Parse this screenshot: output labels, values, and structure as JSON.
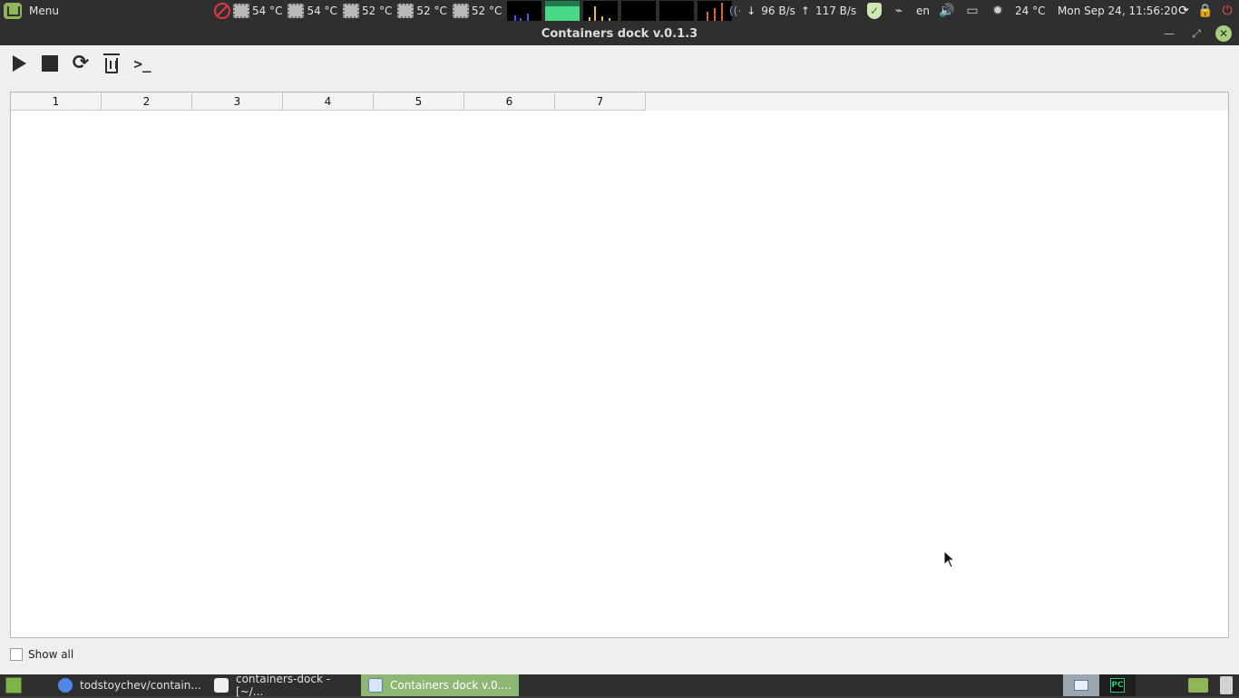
{
  "top_panel": {
    "menu_label": "Menu",
    "temperatures": [
      "54 °C",
      "54 °C",
      "52 °C",
      "52 °C",
      "52 °C"
    ],
    "net_down": "96 B/s",
    "net_up": "117 B/s",
    "keyboard_layout": "en",
    "weather_temp": "24 °C",
    "clock": "Mon Sep 24, 11:56:20"
  },
  "window": {
    "title": "Containers dock v.0.1.3"
  },
  "toolbar": {
    "icons": [
      "play-icon",
      "stop-icon",
      "refresh-icon",
      "trash-icon",
      "terminal-icon"
    ],
    "terminal_glyph": ">_"
  },
  "table": {
    "columns": [
      "1",
      "2",
      "3",
      "4",
      "5",
      "6",
      "7"
    ],
    "rows": []
  },
  "show_all": {
    "label": "Show all",
    "checked": false
  },
  "taskbar": {
    "tasks": [
      {
        "label": "todstoychev/contain...",
        "active": false
      },
      {
        "label": "containers-dock - [~/...",
        "active": false
      },
      {
        "label": "Containers dock v.0....",
        "active": true
      }
    ],
    "pycharm_label": "PC"
  },
  "colors": {
    "panel_bg": "#2f2f2f",
    "app_bg": "#efefef",
    "active_task": "#8fb774",
    "accent_green": "#a7cf7c",
    "power_red": "#ff4b4b"
  }
}
